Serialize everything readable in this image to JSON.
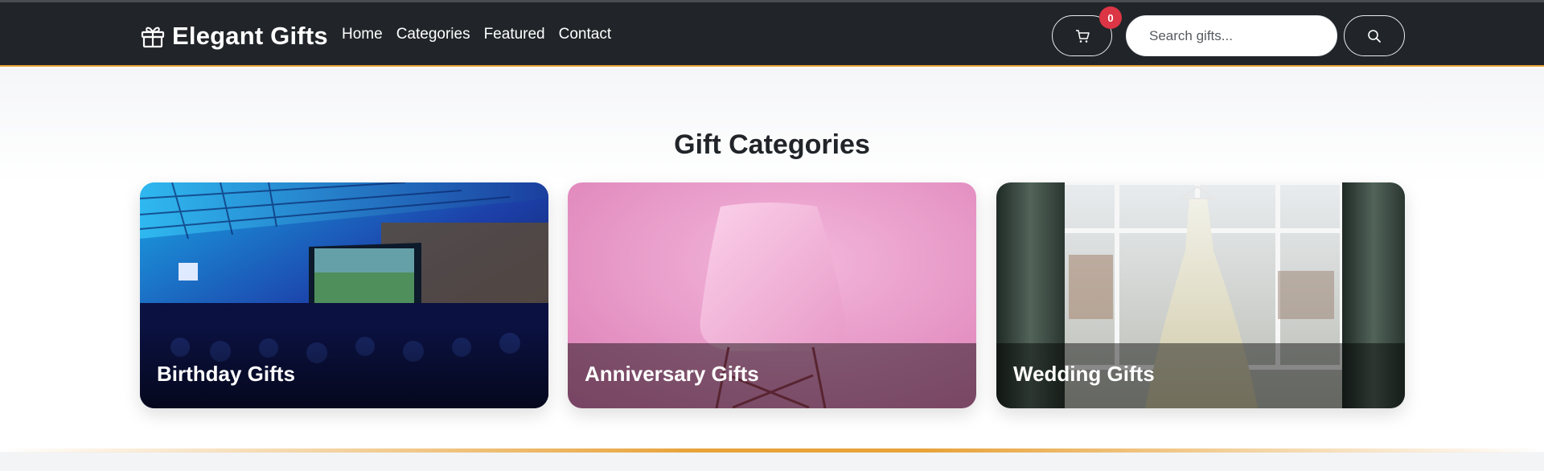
{
  "navbar": {
    "brand": "Elegant Gifts",
    "brand_icon": "gift-icon",
    "links": [
      "Home",
      "Categories",
      "Featured",
      "Contact"
    ],
    "cart_count": "0",
    "cart_icon": "cart-icon",
    "search_placeholder": "Search gifts...",
    "search_icon": "search-icon",
    "accent": "#e8a33a"
  },
  "section": {
    "title": "Gift Categories",
    "cards": [
      {
        "label": "Birthday Gifts",
        "image": "event-audience-photo"
      },
      {
        "label": "Anniversary Gifts",
        "image": "pink-chair-photo"
      },
      {
        "label": "Wedding Gifts",
        "image": "wedding-dress-photo"
      }
    ]
  },
  "colors": {
    "navbar": "#212529",
    "badge": "#dc3545",
    "accent": "#e8a33a"
  }
}
